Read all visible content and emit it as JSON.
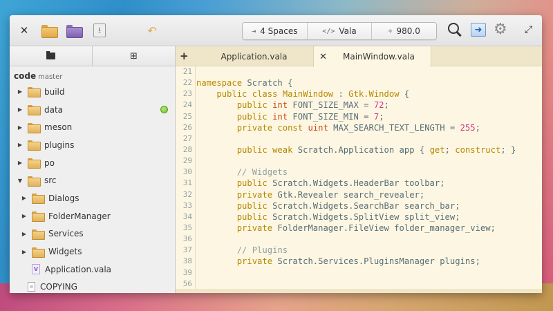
{
  "headerbar": {
    "indent_label": "4 Spaces",
    "language_label": "Vala",
    "zoom_label": "980.0",
    "icons": [
      "close-icon",
      "open-folder-icon",
      "project-folder-icon",
      "save-icon",
      "revert-icon",
      "search-icon",
      "share-icon",
      "gear-icon",
      "fullscreen-icon"
    ]
  },
  "sidebar": {
    "project_name": "code",
    "branch": "master",
    "items": [
      {
        "label": "build",
        "type": "folder",
        "expanded": false,
        "depth": 0
      },
      {
        "label": "data",
        "type": "folder",
        "expanded": false,
        "depth": 0,
        "status": "green-dot"
      },
      {
        "label": "meson",
        "type": "folder",
        "expanded": false,
        "depth": 0
      },
      {
        "label": "plugins",
        "type": "folder",
        "expanded": false,
        "depth": 0
      },
      {
        "label": "po",
        "type": "folder",
        "expanded": false,
        "depth": 0
      },
      {
        "label": "src",
        "type": "folder",
        "expanded": true,
        "depth": 0
      },
      {
        "label": "Dialogs",
        "type": "folder",
        "expanded": false,
        "depth": 1
      },
      {
        "label": "FolderManager",
        "type": "folder",
        "expanded": false,
        "depth": 1
      },
      {
        "label": "Services",
        "type": "folder",
        "expanded": false,
        "depth": 1
      },
      {
        "label": "Widgets",
        "type": "folder",
        "expanded": false,
        "depth": 1
      },
      {
        "label": "Application.vala",
        "type": "vala",
        "depth": 1
      },
      {
        "label": "COPYING",
        "type": "text",
        "depth": 0
      }
    ]
  },
  "editor": {
    "tabs": [
      {
        "label": "Application.vala",
        "active": false
      },
      {
        "label": "MainWindow.vala",
        "active": true
      }
    ],
    "lines": [
      {
        "n": "21",
        "tokens": []
      },
      {
        "n": "22",
        "tokens": [
          [
            "kw",
            "namespace"
          ],
          [
            "p",
            " Scratch {"
          ]
        ]
      },
      {
        "n": "23",
        "tokens": [
          [
            "p",
            "    "
          ],
          [
            "kw",
            "public"
          ],
          [
            "p",
            " "
          ],
          [
            "kw",
            "class"
          ],
          [
            "p",
            " "
          ],
          [
            "kw",
            "MainWindow"
          ],
          [
            "p",
            " : "
          ],
          [
            "kw",
            "Gtk.Window"
          ],
          [
            "p",
            " {"
          ]
        ]
      },
      {
        "n": "24",
        "tokens": [
          [
            "p",
            "        "
          ],
          [
            "kw",
            "public"
          ],
          [
            "p",
            " "
          ],
          [
            "ty",
            "int"
          ],
          [
            "p",
            " FONT_SIZE_MAX = "
          ],
          [
            "num",
            "72"
          ],
          [
            "p",
            ";"
          ]
        ]
      },
      {
        "n": "25",
        "tokens": [
          [
            "p",
            "        "
          ],
          [
            "kw",
            "public"
          ],
          [
            "p",
            " "
          ],
          [
            "ty",
            "int"
          ],
          [
            "p",
            " FONT_SIZE_MIN = "
          ],
          [
            "num",
            "7"
          ],
          [
            "p",
            ";"
          ]
        ]
      },
      {
        "n": "26",
        "tokens": [
          [
            "p",
            "        "
          ],
          [
            "kw",
            "private"
          ],
          [
            "p",
            " "
          ],
          [
            "kw",
            "const"
          ],
          [
            "p",
            " "
          ],
          [
            "ty",
            "uint"
          ],
          [
            "p",
            " MAX_SEARCH_TEXT_LENGTH = "
          ],
          [
            "num",
            "255"
          ],
          [
            "p",
            ";"
          ]
        ]
      },
      {
        "n": "27",
        "tokens": []
      },
      {
        "n": "28",
        "tokens": [
          [
            "p",
            "        "
          ],
          [
            "kw",
            "public"
          ],
          [
            "p",
            " "
          ],
          [
            "kw",
            "weak"
          ],
          [
            "p",
            " Scratch.Application app { "
          ],
          [
            "kw",
            "get"
          ],
          [
            "p",
            "; "
          ],
          [
            "kw",
            "construct"
          ],
          [
            "p",
            "; }"
          ]
        ]
      },
      {
        "n": "29",
        "tokens": []
      },
      {
        "n": "30",
        "tokens": [
          [
            "p",
            "        "
          ],
          [
            "cm",
            "// Widgets"
          ]
        ]
      },
      {
        "n": "31",
        "tokens": [
          [
            "p",
            "        "
          ],
          [
            "kw",
            "public"
          ],
          [
            "p",
            " Scratch.Widgets.HeaderBar toolbar;"
          ]
        ]
      },
      {
        "n": "32",
        "tokens": [
          [
            "p",
            "        "
          ],
          [
            "kw",
            "private"
          ],
          [
            "p",
            " Gtk.Revealer search_revealer;"
          ]
        ]
      },
      {
        "n": "33",
        "tokens": [
          [
            "p",
            "        "
          ],
          [
            "kw",
            "public"
          ],
          [
            "p",
            " Scratch.Widgets.SearchBar search_bar;"
          ]
        ]
      },
      {
        "n": "34",
        "tokens": [
          [
            "p",
            "        "
          ],
          [
            "kw",
            "public"
          ],
          [
            "p",
            " Scratch.Widgets.SplitView split_view;"
          ]
        ]
      },
      {
        "n": "35",
        "tokens": [
          [
            "p",
            "        "
          ],
          [
            "kw",
            "private"
          ],
          [
            "p",
            " FolderManager.FileView folder_manager_view;"
          ]
        ]
      },
      {
        "n": "36",
        "tokens": []
      },
      {
        "n": "37",
        "tokens": [
          [
            "p",
            "        "
          ],
          [
            "cm",
            "// Plugins"
          ]
        ]
      },
      {
        "n": "38",
        "tokens": [
          [
            "p",
            "        "
          ],
          [
            "kw",
            "private"
          ],
          [
            "p",
            " Scratch.Services.PluginsManager plugins;"
          ]
        ]
      },
      {
        "n": "39",
        "tokens": []
      },
      {
        "n": "56",
        "tokens": []
      }
    ]
  }
}
